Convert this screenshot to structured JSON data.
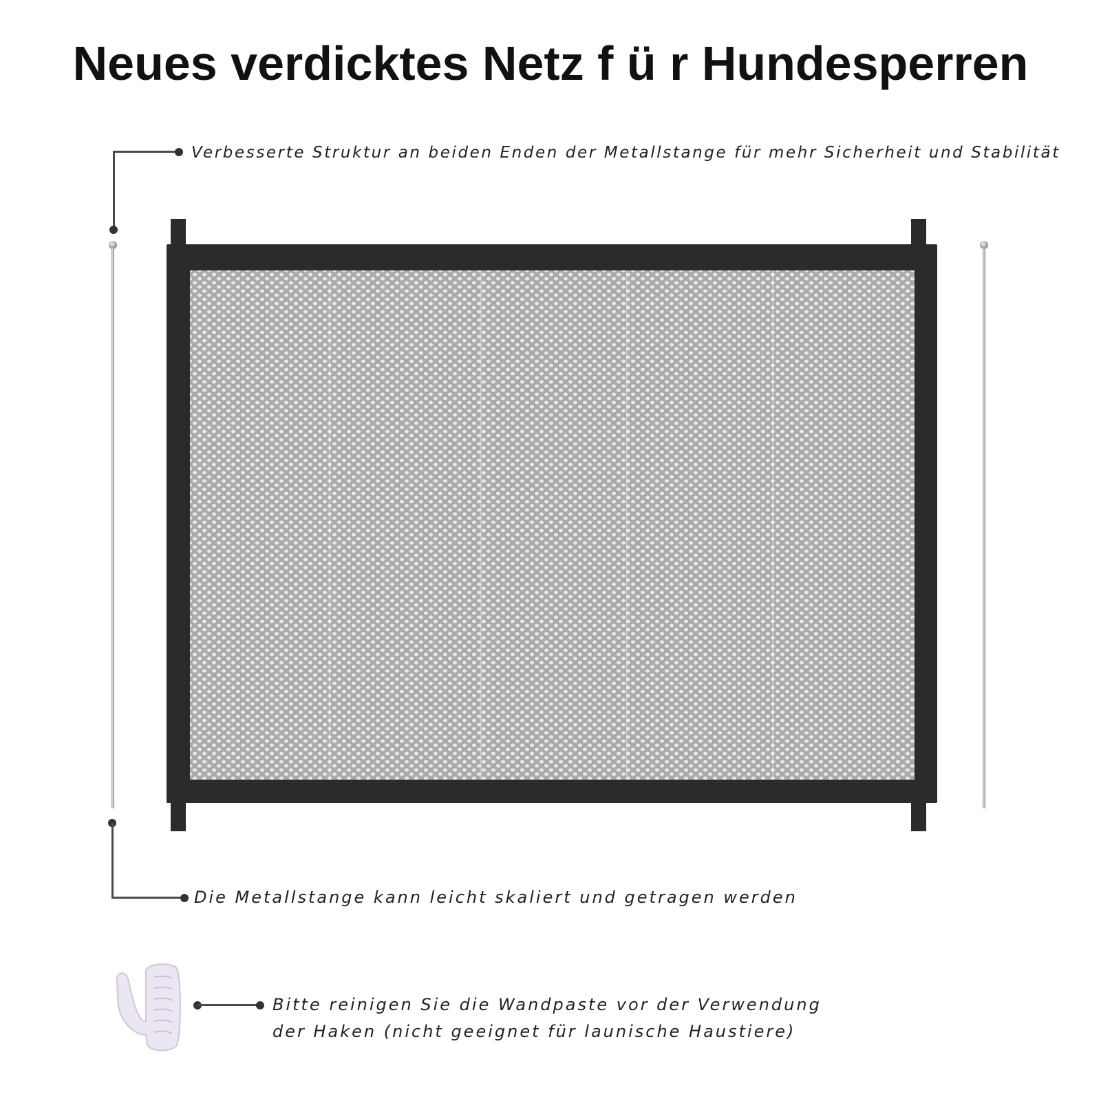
{
  "title": "Neues verdicktes Netz f ü r Hundesperren",
  "callouts": {
    "top": "Verbesserte Struktur an beiden Enden der Metallstange für mehr Sicherheit und Stabilität",
    "middle": "Die Metallstange kann leicht skaliert und getragen werden",
    "bottom_line1": "Bitte reinigen Sie die Wandpaste vor der Verwendung",
    "bottom_line2": "der Haken (nicht geeignet für launische Haustiere)"
  },
  "colors": {
    "frame": "#2b2b2b",
    "mesh": "#aaaaaa",
    "leader": "#4a4a4a",
    "hook": "#ece6f2"
  },
  "icons": {
    "hook": "adhesive-hook-icon",
    "rod": "metal-rod-icon"
  }
}
